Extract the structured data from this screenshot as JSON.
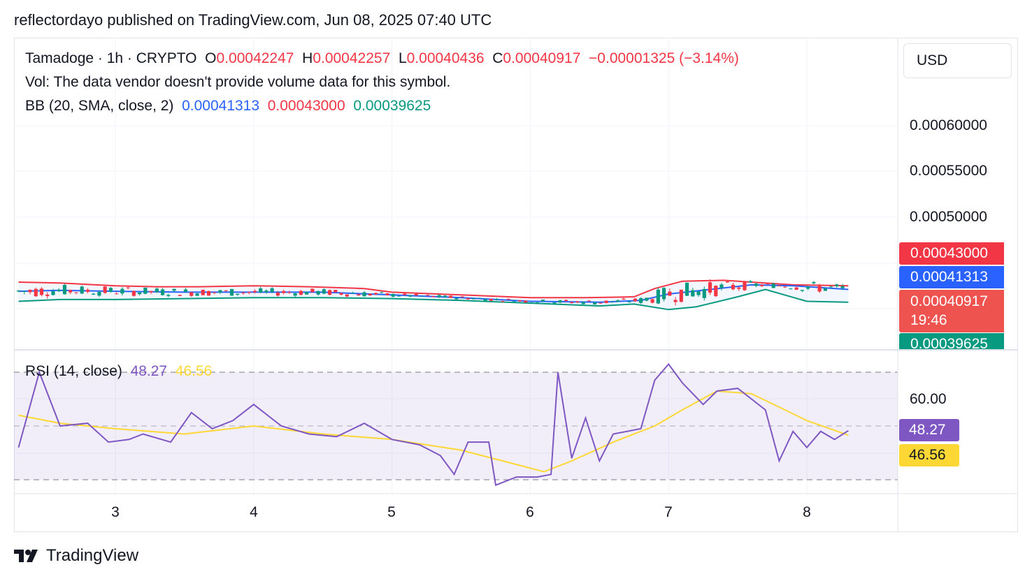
{
  "publish_line": "reflectordayo published on TradingView.com, Jun 08, 2025 07:40 UTC",
  "legend": {
    "symbol": "Tamadoge · 1h · CRYPTO",
    "o_label": "O",
    "o_value": "0.00042247",
    "h_label": "H",
    "h_value": "0.00042257",
    "l_label": "L",
    "l_value": "0.00040436",
    "c_label": "C",
    "c_value": "0.00040917",
    "change": "−0.00001325 (−3.14%)",
    "volume_note": "Vol: The data vendor doesn't provide volume data for this symbol.",
    "bb_label": "BB (20, SMA, close, 2)",
    "bb_basis": "0.00041313",
    "bb_upper": "0.00043000",
    "bb_lower": "0.00039625"
  },
  "rsi_legend": {
    "label": "RSI (14, close)",
    "rsi": "48.27",
    "ma": "46.56"
  },
  "currency_button": "USD",
  "price_axis": [
    "0.00060000",
    "0.00055000",
    "0.00050000"
  ],
  "price_tags": {
    "upper": "0.00043000",
    "basis": "0.00041313",
    "last": "0.00040917",
    "countdown": "19:46",
    "lower": "0.00039625"
  },
  "rsi_axis": [
    "60.00"
  ],
  "rsi_tags": {
    "rsi": "48.27",
    "ma": "46.56"
  },
  "x_axis": [
    "3",
    "4",
    "5",
    "6",
    "7",
    "8"
  ],
  "brand": "TradingView",
  "colors": {
    "up": "#089981",
    "down": "#f23645",
    "bb_basis": "#2962ff",
    "bb_upper": "#f23645",
    "bb_lower": "#089981",
    "rsi": "#7e57c2",
    "rsi_ma": "#fdd835"
  },
  "chart_data": [
    {
      "type": "candlestick",
      "timeframe": "1h",
      "x_ticks": [
        "3",
        "4",
        "5",
        "6",
        "7",
        "8"
      ],
      "ylim": [
        0.00039,
        0.00062
      ],
      "series": [
        {
          "name": "BB upper",
          "points": [
            [
              2.3,
              0.000429
            ],
            [
              2.6,
              0.000428
            ],
            [
              3.0,
              0.000425
            ],
            [
              3.3,
              0.000424
            ],
            [
              3.6,
              0.000424
            ],
            [
              4.0,
              0.000425
            ],
            [
              4.4,
              0.000424
            ],
            [
              4.8,
              0.000422
            ],
            [
              5.0,
              0.000418
            ],
            [
              5.5,
              0.000415
            ],
            [
              6.0,
              0.000412
            ],
            [
              6.4,
              0.000412
            ],
            [
              6.75,
              0.000413
            ],
            [
              6.9,
              0.000422
            ],
            [
              7.1,
              0.00043
            ],
            [
              7.4,
              0.000431
            ],
            [
              7.6,
              0.000429
            ],
            [
              7.9,
              0.000426
            ],
            [
              8.3,
              0.000425
            ]
          ]
        },
        {
          "name": "BB basis",
          "points": [
            [
              2.3,
              0.000419
            ],
            [
              2.6,
              0.00042
            ],
            [
              3.0,
              0.000419
            ],
            [
              3.5,
              0.000418
            ],
            [
              4.0,
              0.000418
            ],
            [
              4.5,
              0.000418
            ],
            [
              5.0,
              0.000415
            ],
            [
              5.5,
              0.000412
            ],
            [
              6.0,
              0.000408
            ],
            [
              6.5,
              0.000407
            ],
            [
              6.8,
              0.000409
            ],
            [
              7.0,
              0.000416
            ],
            [
              7.3,
              0.000421
            ],
            [
              7.6,
              0.000426
            ],
            [
              7.9,
              0.000425
            ],
            [
              8.3,
              0.000421
            ]
          ]
        },
        {
          "name": "BB lower",
          "points": [
            [
              2.3,
              0.000408
            ],
            [
              2.6,
              0.00041
            ],
            [
              3.0,
              0.00041
            ],
            [
              3.5,
              0.000411
            ],
            [
              4.0,
              0.000412
            ],
            [
              4.5,
              0.000412
            ],
            [
              5.0,
              0.000411
            ],
            [
              5.5,
              0.000409
            ],
            [
              6.0,
              0.000406
            ],
            [
              6.5,
              0.000403
            ],
            [
              6.75,
              0.000405
            ],
            [
              7.0,
              0.000399
            ],
            [
              7.2,
              0.000402
            ],
            [
              7.5,
              0.000413
            ],
            [
              7.7,
              0.000421
            ],
            [
              8.0,
              0.000408
            ],
            [
              8.3,
              0.000407
            ]
          ]
        }
      ]
    },
    {
      "type": "line",
      "name": "RSI (14, close)",
      "x_ticks": [
        "3",
        "4",
        "5",
        "6",
        "7",
        "8"
      ],
      "ylim": [
        22,
        80
      ],
      "bands": [
        30,
        70
      ],
      "series": [
        {
          "name": "RSI",
          "points": [
            [
              2.3,
              42
            ],
            [
              2.45,
              70
            ],
            [
              2.6,
              50
            ],
            [
              2.8,
              51
            ],
            [
              2.95,
              44
            ],
            [
              3.1,
              45
            ],
            [
              3.2,
              47
            ],
            [
              3.4,
              44
            ],
            [
              3.55,
              55
            ],
            [
              3.7,
              49
            ],
            [
              3.85,
              52
            ],
            [
              4.0,
              58
            ],
            [
              4.2,
              50
            ],
            [
              4.4,
              47
            ],
            [
              4.6,
              46
            ],
            [
              4.8,
              51
            ],
            [
              5.0,
              45
            ],
            [
              5.2,
              43
            ],
            [
              5.35,
              39
            ],
            [
              5.45,
              32
            ],
            [
              5.55,
              44
            ],
            [
              5.7,
              44
            ],
            [
              5.75,
              28
            ],
            [
              5.9,
              31
            ],
            [
              6.05,
              31
            ],
            [
              6.15,
              32
            ],
            [
              6.2,
              70
            ],
            [
              6.3,
              38
            ],
            [
              6.4,
              53
            ],
            [
              6.5,
              37
            ],
            [
              6.6,
              47
            ],
            [
              6.8,
              49
            ],
            [
              6.9,
              67
            ],
            [
              7.0,
              73
            ],
            [
              7.1,
              66
            ],
            [
              7.25,
              58
            ],
            [
              7.35,
              63
            ],
            [
              7.5,
              64
            ],
            [
              7.6,
              60
            ],
            [
              7.7,
              56
            ],
            [
              7.8,
              37
            ],
            [
              7.9,
              48
            ],
            [
              8.0,
              42
            ],
            [
              8.1,
              48
            ],
            [
              8.2,
              45
            ],
            [
              8.3,
              48.27
            ]
          ]
        },
        {
          "name": "RSI MA",
          "points": [
            [
              2.3,
              54
            ],
            [
              2.6,
              51
            ],
            [
              3.0,
              49
            ],
            [
              3.5,
              47
            ],
            [
              4.0,
              50
            ],
            [
              4.5,
              47
            ],
            [
              5.0,
              45
            ],
            [
              5.5,
              41
            ],
            [
              5.8,
              37
            ],
            [
              6.1,
              33
            ],
            [
              6.3,
              37
            ],
            [
              6.6,
              44
            ],
            [
              6.9,
              50
            ],
            [
              7.1,
              56
            ],
            [
              7.35,
              63
            ],
            [
              7.6,
              62
            ],
            [
              7.8,
              57
            ],
            [
              8.0,
              52
            ],
            [
              8.3,
              46.56
            ]
          ]
        }
      ]
    }
  ]
}
